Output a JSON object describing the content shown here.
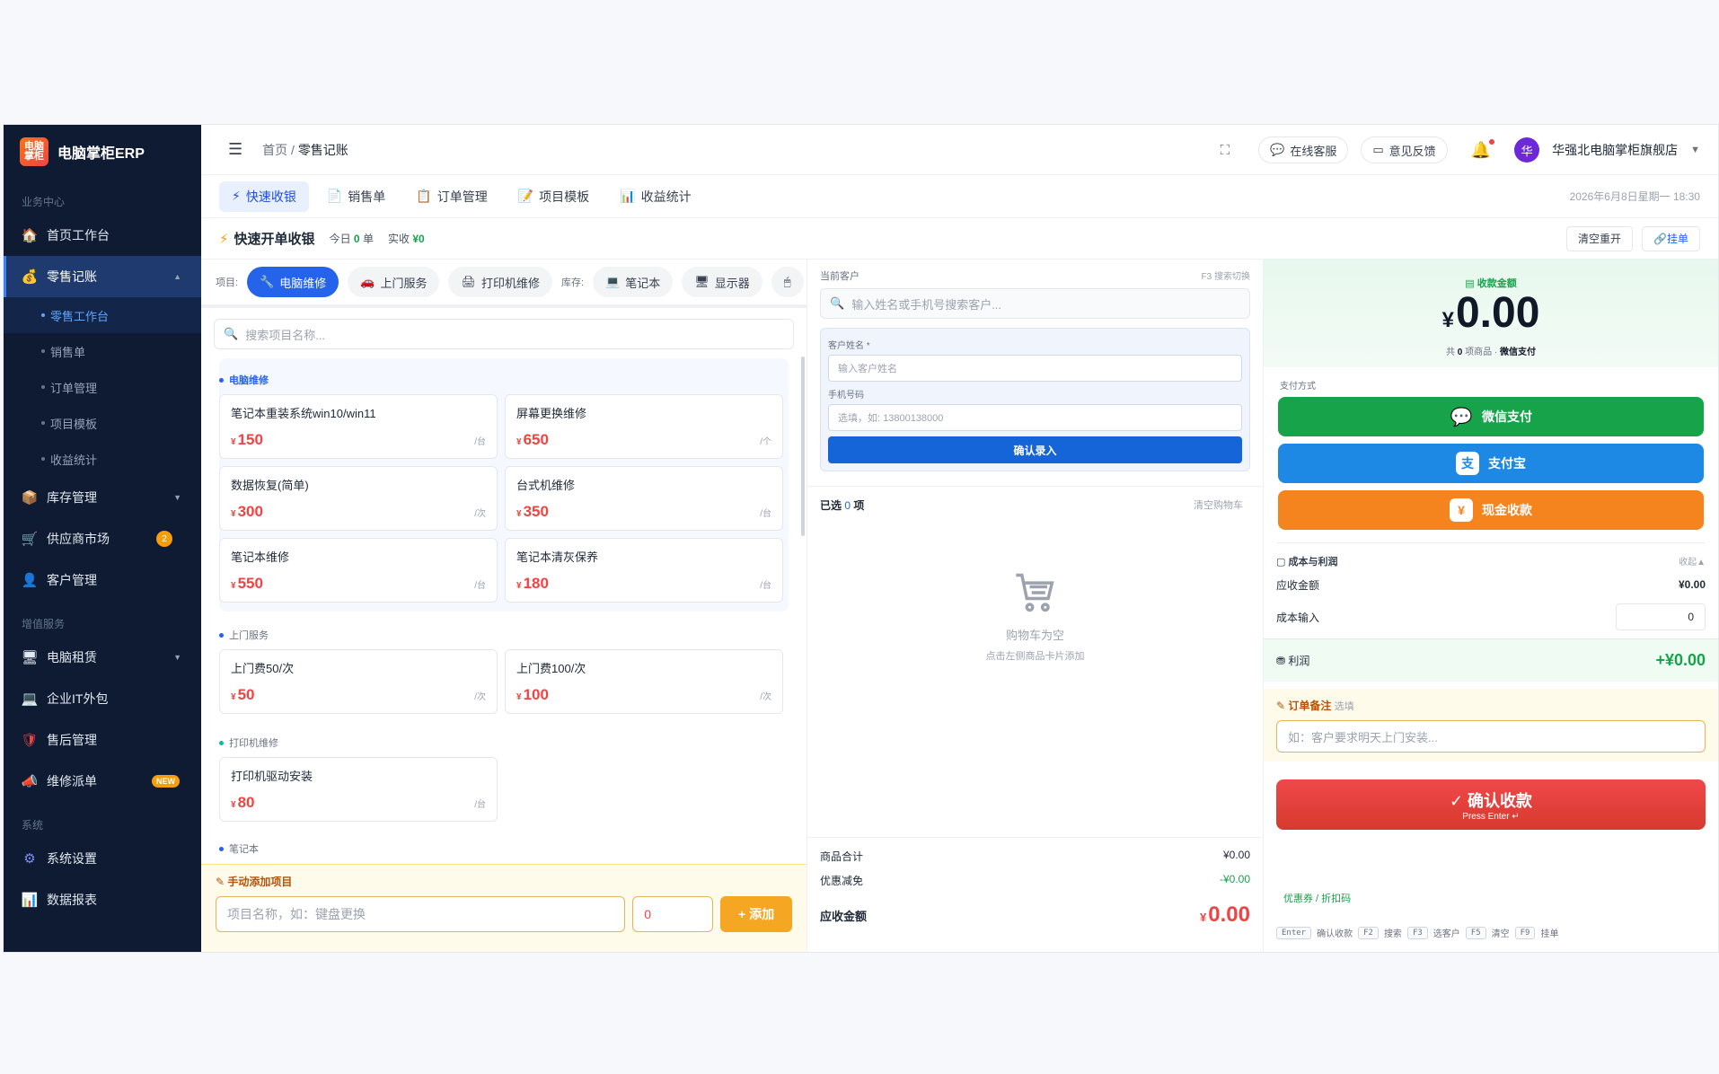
{
  "app": {
    "logo_mark": "电脑掌柜",
    "title": "电脑掌柜ERP"
  },
  "sidebar": {
    "sections": [
      "业务中心",
      "增值服务",
      "系统"
    ],
    "items": [
      {
        "label": "首页工作台",
        "icon": "home-icon"
      },
      {
        "label": "零售记账",
        "icon": "money-bag-icon"
      },
      {
        "label": "库存管理",
        "icon": "box-icon"
      },
      {
        "label": "供应商市场",
        "icon": "cart-icon",
        "badge": "2"
      },
      {
        "label": "客户管理",
        "icon": "user-icon"
      },
      {
        "label": "电脑租赁",
        "icon": "computer-icon"
      },
      {
        "label": "企业IT外包",
        "icon": "monitor-icon"
      },
      {
        "label": "售后管理",
        "icon": "shield-icon"
      },
      {
        "label": "维修派单",
        "icon": "megaphone-icon",
        "badge": "NEW"
      },
      {
        "label": "系统设置",
        "icon": "gear-icon"
      },
      {
        "label": "数据报表",
        "icon": "chart-icon"
      }
    ],
    "subitems": [
      "零售工作台",
      "销售单",
      "订单管理",
      "项目模板",
      "收益统计"
    ]
  },
  "topbar": {
    "crumb_home": "首页",
    "crumb_sep": " / ",
    "crumb_current": "零售记账",
    "service": "在线客服",
    "feedback": "意见反馈",
    "avatar": "华",
    "store": "华强北电脑掌柜旗舰店"
  },
  "tabs": [
    "快速收银",
    "销售单",
    "订单管理",
    "项目模板",
    "收益统计"
  ],
  "date": "2026年6月8日星期一 18:30",
  "titlebar": {
    "title": "快速开单收银",
    "today_label": "今日",
    "today_count": "0",
    "today_unit": "单",
    "received_label": "实收",
    "received_value": "¥0",
    "reset": "清空重开",
    "hold": "挂单"
  },
  "categories": {
    "project_label": "项目:",
    "stock_label": "库存:",
    "chips": [
      "电脑维修",
      "上门服务",
      "打印机维修"
    ],
    "stock_chips": [
      "笔记本",
      "显示器"
    ]
  },
  "search_placeholder": "搜索项目名称...",
  "groups": [
    {
      "title": "电脑维修",
      "items": [
        {
          "name": "笔记本重装系统win10/win11",
          "price": "150",
          "unit": "/台"
        },
        {
          "name": "屏幕更换维修",
          "price": "650",
          "unit": "/个"
        },
        {
          "name": "数据恢复(简单)",
          "price": "300",
          "unit": "/次"
        },
        {
          "name": "台式机维修",
          "price": "350",
          "unit": "/台"
        },
        {
          "name": "笔记本维修",
          "price": "550",
          "unit": "/台"
        },
        {
          "name": "笔记本清灰保养",
          "price": "180",
          "unit": "/台"
        }
      ]
    },
    {
      "title": "上门服务",
      "items": [
        {
          "name": "上门费50/次",
          "price": "50",
          "unit": "/次"
        },
        {
          "name": "上门费100/次",
          "price": "100",
          "unit": "/次"
        }
      ]
    },
    {
      "title": "打印机维修",
      "items": [
        {
          "name": "打印机驱动安装",
          "price": "80",
          "unit": "/台"
        }
      ]
    },
    {
      "title": "笔记本",
      "items": []
    }
  ],
  "currency": "¥",
  "manual": {
    "title": "手动添加项目",
    "name_placeholder": "项目名称，如：键盘更换",
    "price_value": "0",
    "add": "+ 添加"
  },
  "customer": {
    "label": "当前客户",
    "hint": "F3 搜索切换",
    "search_placeholder": "输入姓名或手机号搜索客户...",
    "name_label": "客户姓名 *",
    "name_placeholder": "输入客户姓名",
    "phone_label": "手机号码",
    "phone_placeholder": "选填，如: 13800138000",
    "confirm": "确认录入"
  },
  "cart": {
    "selected_prefix": "已选",
    "selected_count": "0",
    "selected_suffix": "项",
    "clear": "清空购物车",
    "empty_title": "购物车为空",
    "empty_hint": "点击左侧商品卡片添加",
    "subtotal_label": "商品合计",
    "subtotal": "¥0.00",
    "discount_label": "优惠减免",
    "discount": "-¥0.00",
    "due_label": "应收金额",
    "due": "0.00"
  },
  "payment": {
    "amount_label": "收款金额",
    "amount": "0.00",
    "sub_prefix": "共",
    "sub_count": "0",
    "sub_mid": "项商品 ·",
    "sub_method": "微信支付",
    "method_label": "支付方式",
    "wechat": "微信支付",
    "alipay": "支付宝",
    "alipay_icon_glyph": "支",
    "cash": "现金收款",
    "cash_icon_glyph": "¥"
  },
  "profit": {
    "title": "成本与利润",
    "collapse": "收起▲",
    "receivable_label": "应收金额",
    "receivable": "¥0.00",
    "cost_label": "成本输入",
    "cost_value": "0",
    "profit_label": "利润",
    "profit": "+¥0.00"
  },
  "note": {
    "label": "订单备注",
    "optional": "选填",
    "placeholder": "如：客户要求明天上门安装..."
  },
  "confirm": {
    "main": "确认收款",
    "sub": "Press Enter ↵"
  },
  "coupon": "优惠券 / 折扣码",
  "shortcuts": [
    {
      "key": "Enter",
      "label": "确认收款"
    },
    {
      "key": "F2",
      "label": "搜索"
    },
    {
      "key": "F3",
      "label": "选客户"
    },
    {
      "key": "F5",
      "label": "清空"
    },
    {
      "key": "F9",
      "label": "挂单"
    }
  ],
  "colors": {
    "primary": "#2563eb",
    "wechat": "#16a34a",
    "alipay": "#1e88e5",
    "cash": "#f5841f",
    "danger": "#ef4444",
    "sidebar": "#0f1b33"
  }
}
